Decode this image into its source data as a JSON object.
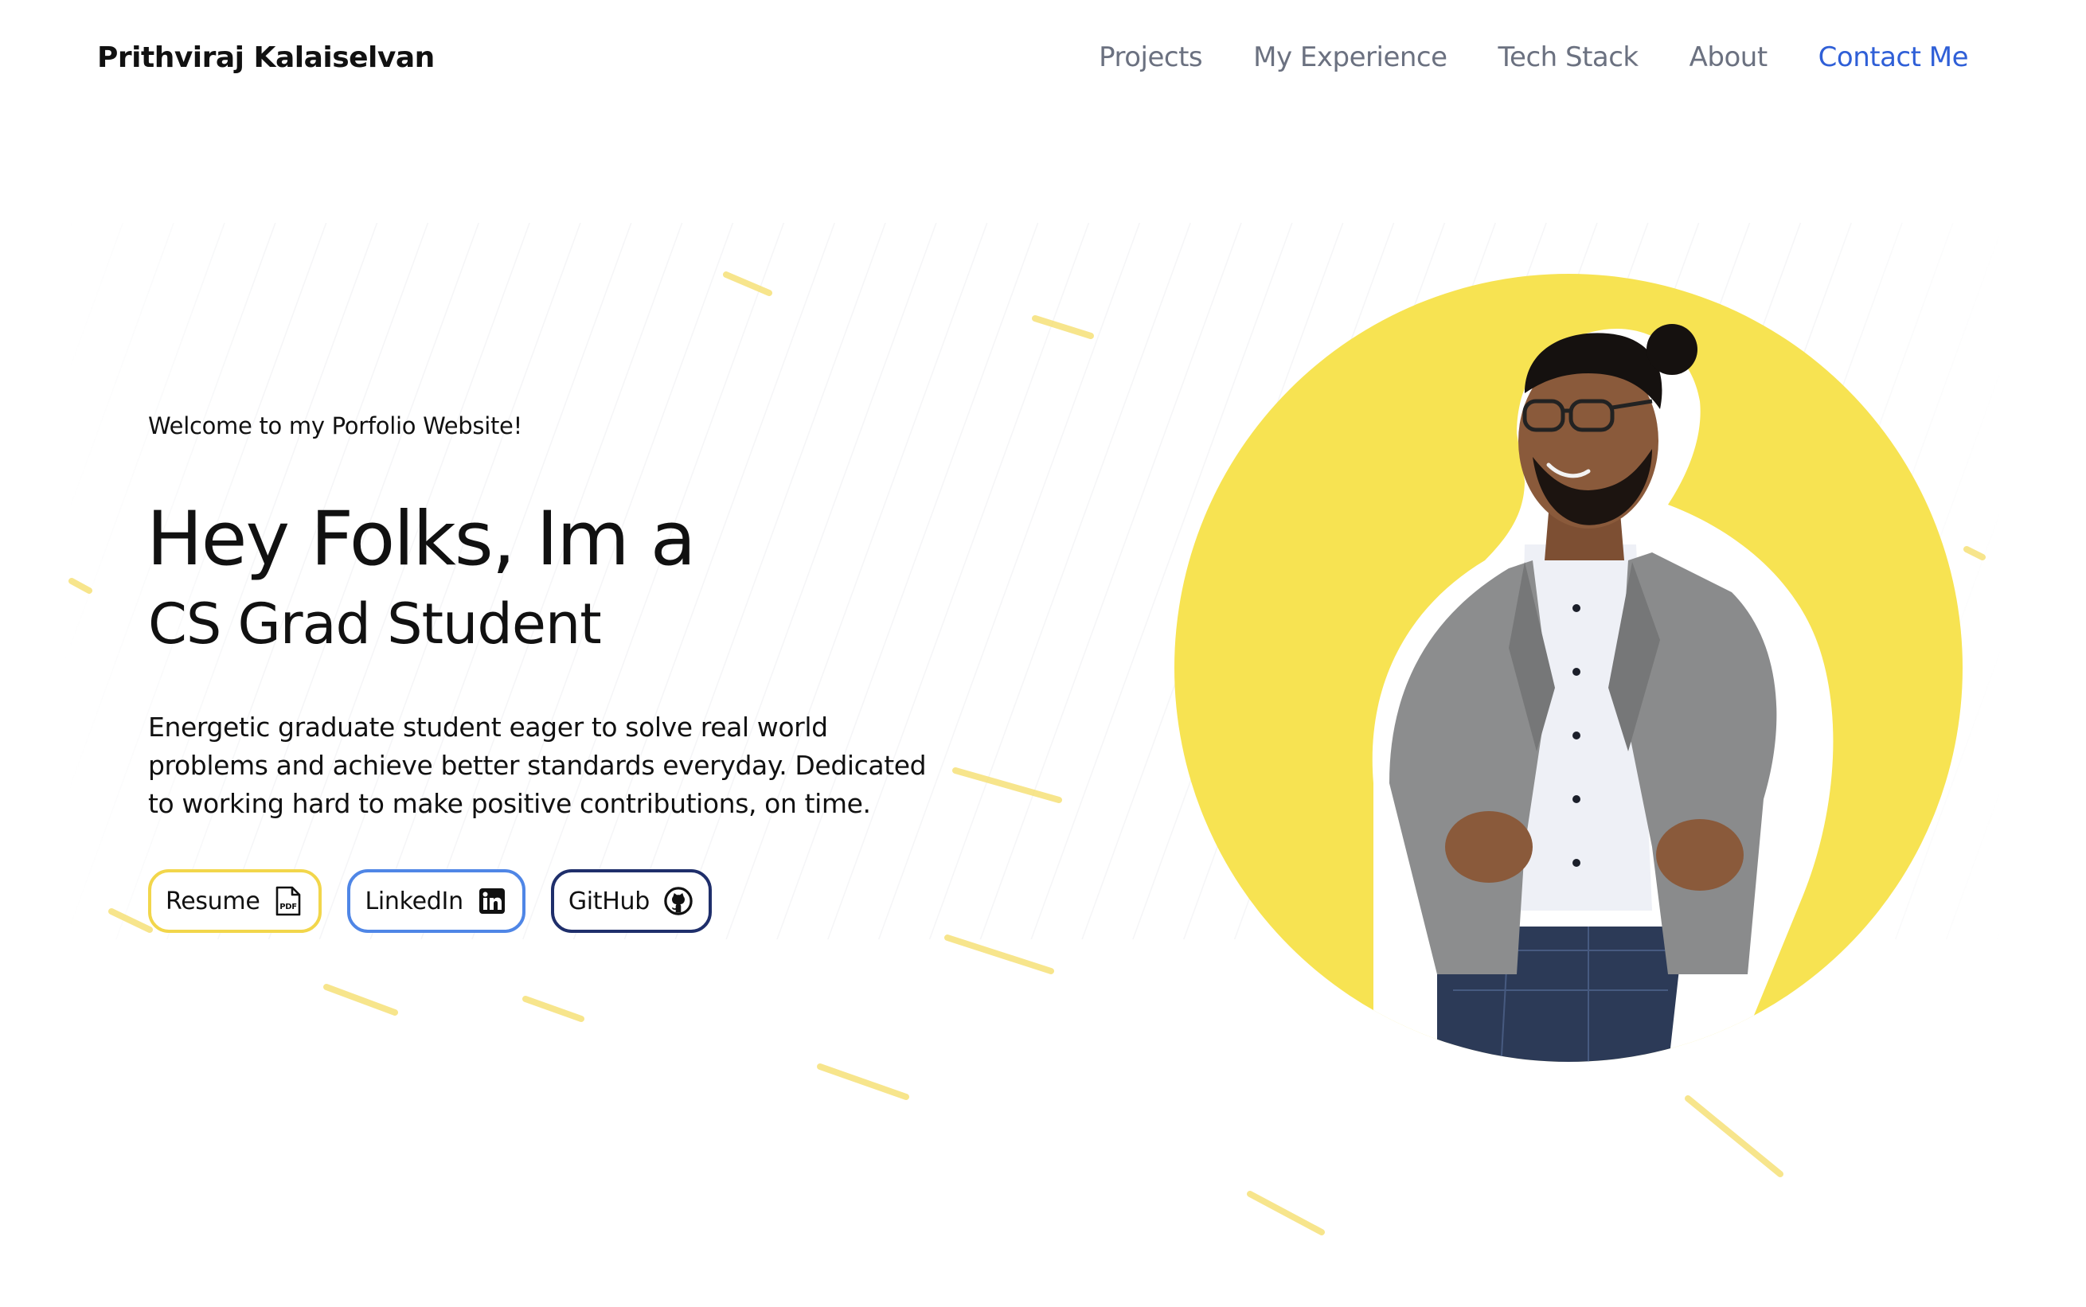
{
  "header": {
    "brand": "Prithviraj Kalaiselvan",
    "nav": {
      "projects": "Projects",
      "experience": "My Experience",
      "tech_stack": "Tech Stack",
      "about": "About",
      "contact": "Contact Me"
    }
  },
  "hero": {
    "welcome": "Welcome to my Porfolio Website!",
    "headline": "Hey Folks, Im a",
    "subheadline": "CS Grad Student",
    "description": "Energetic graduate student eager to solve real world problems and achieve better standards everyday. Dedicated to working hard to make positive contributions, on time.",
    "buttons": {
      "resume": "Resume",
      "linkedin": "LinkedIn",
      "github": "GitHub"
    },
    "icons": {
      "resume": "pdf-icon",
      "linkedin": "linkedin-icon",
      "github": "github-icon"
    }
  },
  "colors": {
    "accent_yellow": "#f7e352",
    "nav_active": "#2f5fd7",
    "nav_text": "#6b7180",
    "resume_border": "#f2d64b",
    "linkedin_border": "#4f86e6",
    "github_border": "#1f2f6b"
  }
}
